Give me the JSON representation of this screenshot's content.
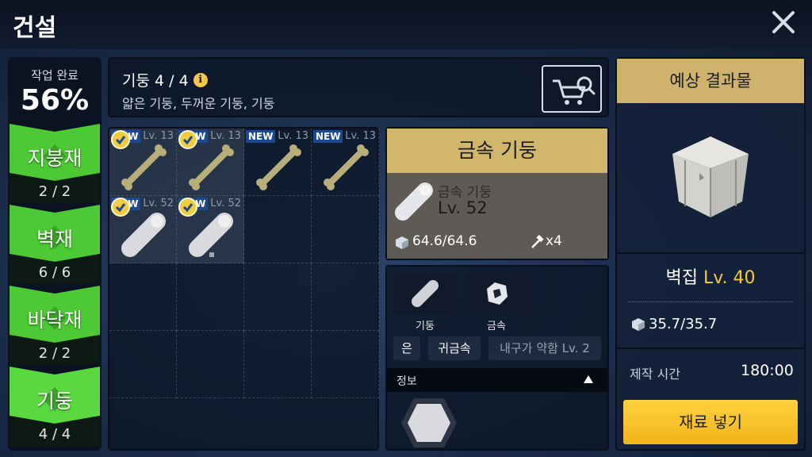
{
  "window": {
    "title": "건설"
  },
  "progress": {
    "label": "작업 완료",
    "value": "56%"
  },
  "categories": [
    {
      "name": "지붕재",
      "count": "2 / 2"
    },
    {
      "name": "벽재",
      "count": "6 / 6"
    },
    {
      "name": "바닥재",
      "count": "2 / 2"
    },
    {
      "name": "기둥",
      "count": "4 / 4"
    }
  ],
  "header": {
    "title": "기둥 4 / 4",
    "subtitle": "얇은 기둥, 두꺼운 기둥, 기둥"
  },
  "grid": {
    "items": [
      {
        "badge": "new-check",
        "badge_text": "NEW",
        "level": "Lv. 13",
        "icon": "bone-icon"
      },
      {
        "badge": "new-check",
        "badge_text": "NEW",
        "level": "Lv. 13",
        "icon": "bone-icon"
      },
      {
        "badge": "new",
        "badge_text": "NEW",
        "level": "Lv. 13",
        "icon": "bone-icon"
      },
      {
        "badge": "new",
        "badge_text": "NEW",
        "level": "Lv. 13",
        "icon": "bone-icon"
      },
      {
        "badge": "new-check",
        "badge_text": "NEW",
        "level": "Lv. 52",
        "icon": "metal-pillar-icon"
      },
      {
        "badge": "new-check",
        "badge_text": "NEW",
        "level": "Lv. 52",
        "icon": "metal-pillar-icon"
      }
    ]
  },
  "detail": {
    "header": "금속 기둥",
    "name": "금속 기둥",
    "level": "Lv. 52",
    "durability": "64.6/64.6",
    "count": "x4"
  },
  "props": {
    "chips": [
      {
        "label": "기둥",
        "icon": "pillar-icon"
      },
      {
        "label": "금속",
        "icon": "metal-icon"
      }
    ],
    "tags": [
      "은",
      "귀금속",
      "내구가 약함 Lv. 2"
    ],
    "info_label": "정보"
  },
  "result": {
    "header": "예상 결과물",
    "name": "벽집",
    "level": "Lv. 40",
    "durability": "35.7/35.7",
    "time_label": "제작 시간",
    "time_value": "180:00",
    "submit_label": "재료 넣기"
  },
  "colors": {
    "tab_green": "#4cc934",
    "tab_dark": "#0d1a14",
    "gold_header": "#d2b66c",
    "accent_yellow": "#f3c93f",
    "submit_yellow": "#ffd23e",
    "new_badge": "#1d4a8e",
    "bone": "#b8ae7a",
    "metal": "#d8dadd"
  }
}
